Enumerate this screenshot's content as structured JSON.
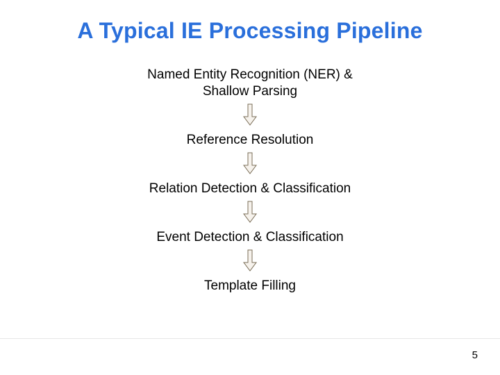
{
  "title": "A Typical IE Processing Pipeline",
  "steps": {
    "s0a": "Named Entity Recognition (NER) &",
    "s0b": "Shallow Parsing",
    "s1": "Reference Resolution",
    "s2": "Relation Detection & Classification",
    "s3": "Event Detection & Classification",
    "s4": "Template Filling"
  },
  "page": "5",
  "arrow": {
    "fill": "#f6f2ec",
    "stroke": "#7a6e57"
  }
}
